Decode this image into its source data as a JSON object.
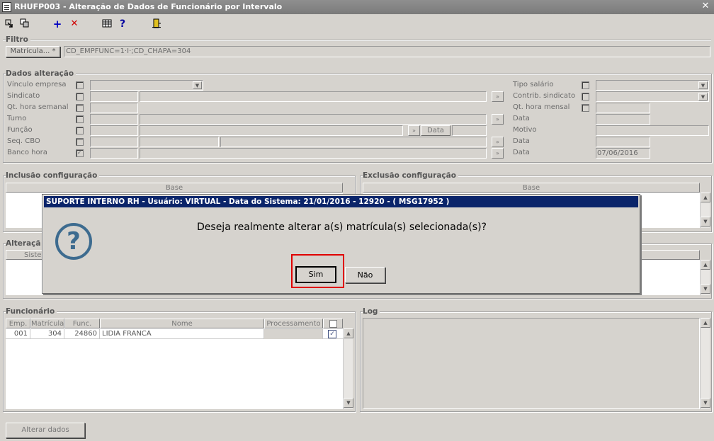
{
  "window": {
    "title": "RHUFP003 - Alteração de Dados de Funcionário por Intervalo",
    "close_glyph": "✕"
  },
  "toolbar": {
    "add_glyph": "+",
    "delete_glyph": "✕",
    "help_glyph": "?"
  },
  "filtro": {
    "title": "Filtro",
    "matricula_button": "Matrícula... *",
    "expression": "CD_EMPFUNC=1·I·;CD_CHAPA=304"
  },
  "dados": {
    "title": "Dados alteração",
    "left_labels": [
      "Vínculo empresa",
      "Sindicato",
      "Qt. hora semanal",
      "Turno",
      "Função",
      "Seq. CBO",
      "Banco hora"
    ],
    "right_labels": [
      "Tipo salário",
      "Contrib. sindicato",
      "Qt. hora mensal",
      "Data",
      "Motivo",
      "Data",
      "Data"
    ],
    "funcao_data_label": "Data",
    "banco_data_value": "07/06/2016",
    "zoom_glyph": "»",
    "dropdown_glyph": "▼"
  },
  "inclusao": {
    "title": "Inclusão configuração",
    "col": "Base"
  },
  "exclusao": {
    "title": "Exclusão configuração",
    "col": "Base"
  },
  "alteracao": {
    "title": "Alteraçã",
    "col": "Siste"
  },
  "funcionario": {
    "title": "Funcionário",
    "columns": [
      "Emp.",
      "Matrícula",
      "Func.",
      "Nome",
      "Processamento"
    ],
    "rows": [
      {
        "emp": "001",
        "matricula": "304",
        "func": "24860",
        "nome": "LIDIA FRANCA",
        "processamento": ""
      }
    ]
  },
  "log": {
    "title": "Log"
  },
  "footer": {
    "alterar_button": "Alterar dados"
  },
  "dialog": {
    "title": "SUPORTE INTERNO RH - Usuário: VIRTUAL - Data do Sistema: 21/01/2016 - 12920 - ( MSG17952 )",
    "message": "Deseja realmente alterar a(s) matrícula(s) selecionada(s)?",
    "yes_button": "Sim",
    "no_button": "Não",
    "icon_glyph": "?"
  },
  "colors": {
    "dialog_title_bg": "#0a246a",
    "highlight_border": "#e00000",
    "icon_color": "#3d6b8f"
  }
}
